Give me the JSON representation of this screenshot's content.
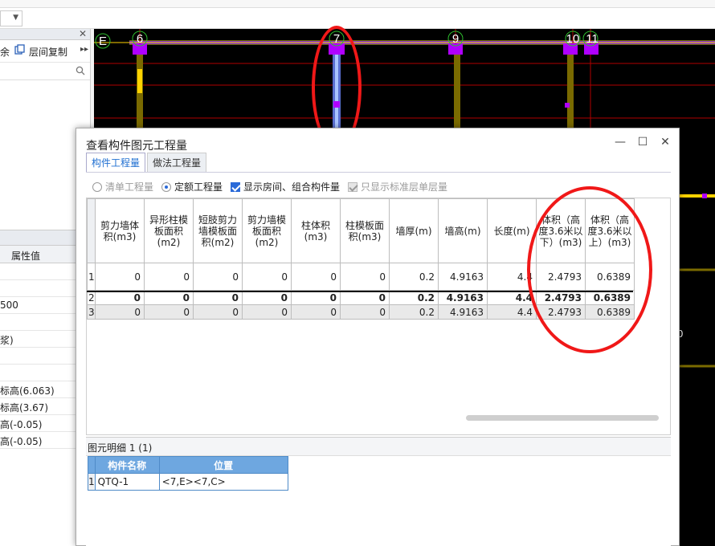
{
  "app": {
    "left_panel": {
      "toolbar": {
        "delete_partial": "余",
        "floor_copy": "层间复制"
      },
      "property_header": "属性值",
      "property_rows": [
        "",
        "",
        "500",
        "",
        "浆)",
        "",
        "",
        "标高(6.063)",
        "标高(3.67)",
        "高(-0.05)",
        "高(-0.05)"
      ]
    },
    "canvas": {
      "axis_labels": [
        "E",
        "6",
        "7",
        "9",
        "10",
        "11"
      ],
      "side_numeral": "0"
    }
  },
  "dialog": {
    "title": "查看构件图元工程量",
    "tabs": [
      {
        "label": "构件工程量",
        "active": true
      },
      {
        "label": "做法工程量",
        "active": false
      }
    ],
    "options": {
      "list_quantity": "清单工程量",
      "quota_quantity": "定额工程量",
      "show_rooms": "显示房间、组合构件量",
      "standard_floor_only": "只显示标准层单层量"
    },
    "table": {
      "columns": [
        "剪力墙体积(m3)",
        "异形柱模板面积(m2)",
        "短肢剪力墙模板面积(m2)",
        "剪力墙模板面积(m2)",
        "柱体积(m3)",
        "柱模板面积(m3)",
        "墙厚(m)",
        "墙高(m)",
        "长度(m)",
        "体积（高度3.6米以下）(m3)",
        "体积（高度3.6米以上）(m3)"
      ],
      "rows": [
        {
          "num": "1",
          "cells": [
            "0",
            "0",
            "0",
            "0",
            "0",
            "0",
            "0.2",
            "4.9163",
            "4.4",
            "2.4793",
            "0.6389"
          ]
        },
        {
          "num": "2",
          "cells": [
            "0",
            "0",
            "0",
            "0",
            "0",
            "0",
            "0.2",
            "4.9163",
            "4.4",
            "2.4793",
            "0.6389"
          ]
        },
        {
          "num": "3",
          "cells": [
            "0",
            "0",
            "0",
            "0",
            "0",
            "0",
            "0.2",
            "4.9163",
            "4.4",
            "2.4793",
            "0.6389"
          ]
        }
      ]
    },
    "detail": {
      "title": "图元明细  1 (1)",
      "columns": [
        "构件名称",
        "位置"
      ],
      "rows": [
        {
          "num": "1",
          "name": "QTQ-1",
          "position": "<7,E><7,C>"
        }
      ]
    }
  }
}
